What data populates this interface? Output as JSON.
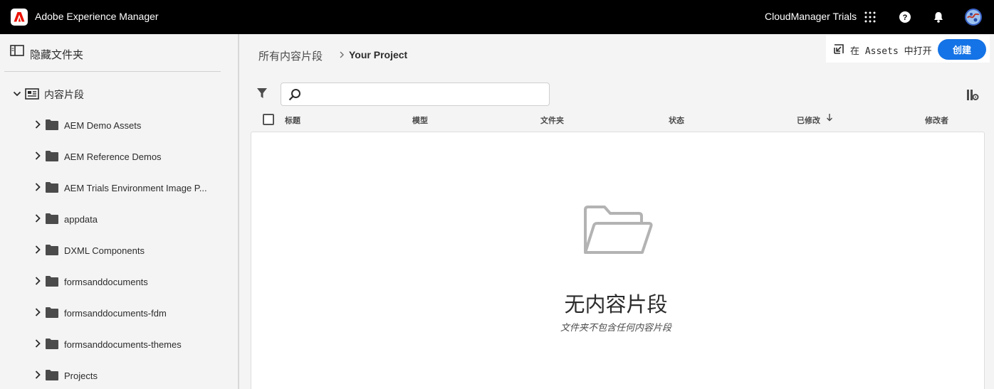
{
  "header": {
    "app_title": "Adobe Experience Manager",
    "org_name": "CloudManager Trials",
    "icons": [
      "adobe-logo-icon",
      "apps-grid-icon",
      "help-icon",
      "notification-bell-icon",
      "user-avatar-icon"
    ]
  },
  "sidebar": {
    "toggle_label": "隐藏文件夹",
    "root_label": "内容片段",
    "items": [
      {
        "label": "AEM Demo Assets"
      },
      {
        "label": "AEM Reference Demos"
      },
      {
        "label": "AEM Trials Environment Image P..."
      },
      {
        "label": "appdata"
      },
      {
        "label": "DXML Components"
      },
      {
        "label": "formsanddocuments"
      },
      {
        "label": "formsanddocuments-fdm"
      },
      {
        "label": "formsanddocuments-themes"
      },
      {
        "label": "Projects"
      }
    ]
  },
  "breadcrumb": {
    "root": "所有内容片段",
    "current": "Your Project"
  },
  "actions": {
    "open_in_assets": "在 Assets 中打开",
    "create": "创建"
  },
  "search": {
    "placeholder": "",
    "value": ""
  },
  "table": {
    "columns": [
      "标题",
      "模型",
      "文件夹",
      "状态",
      "已修改",
      "修改者"
    ],
    "sorted_column": "已修改",
    "sort_direction": "descending",
    "rows": []
  },
  "empty_state": {
    "title": "无内容片段",
    "subtitle": "文件夹不包含任何内容片段"
  },
  "colors": {
    "header_bg": "#000000",
    "accent": "#1473e6",
    "adobe_red": "#eb1000"
  }
}
